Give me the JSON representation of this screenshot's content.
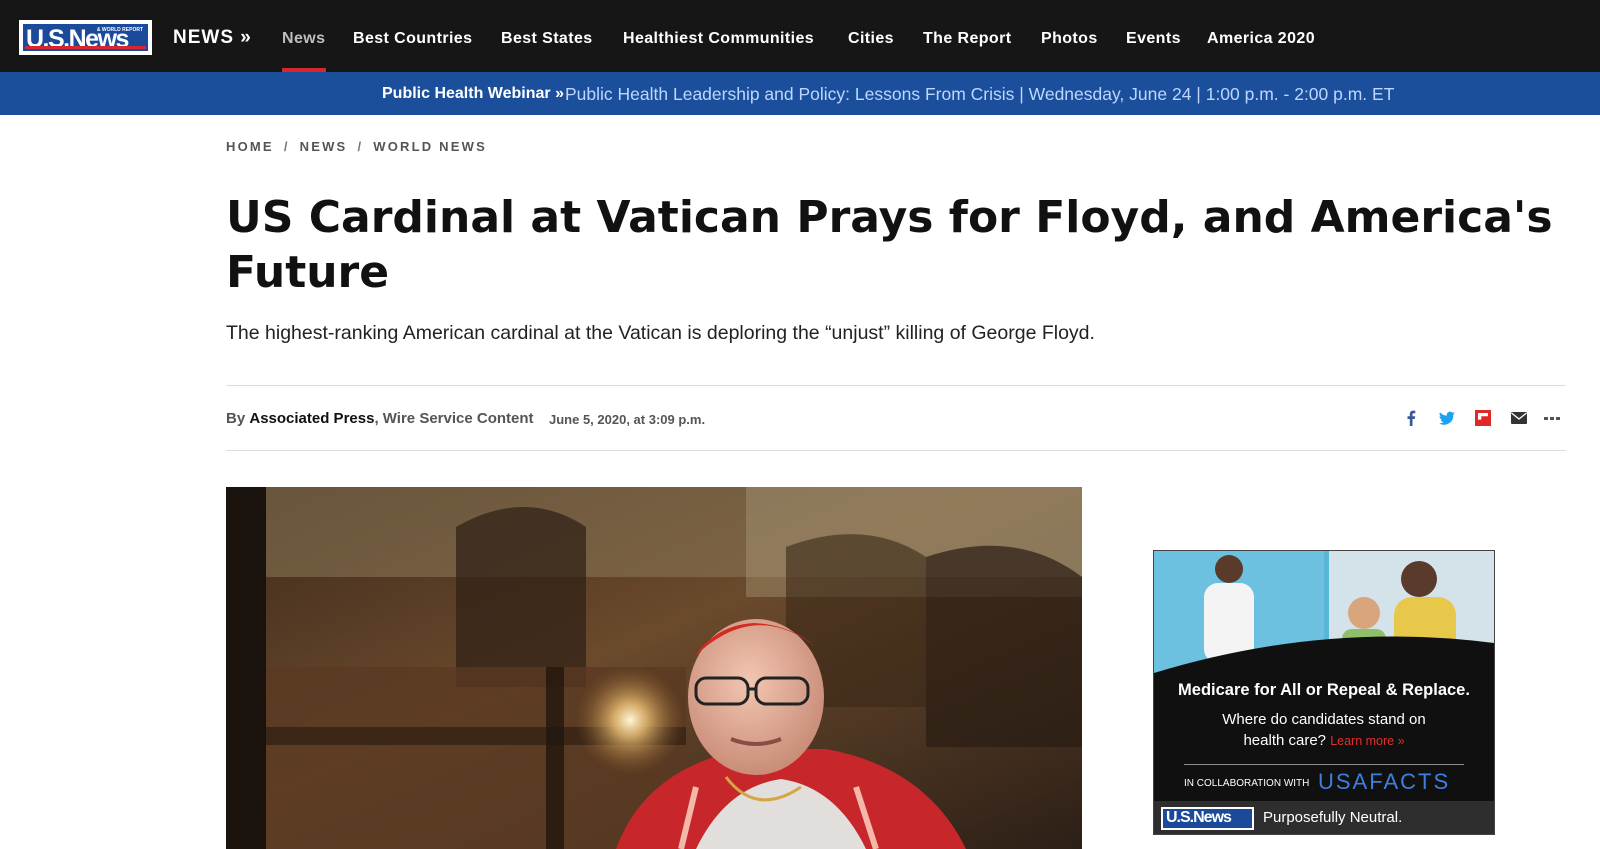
{
  "brand": {
    "logo_text": "U.S.News",
    "logo_small": "& WORLD REPORT",
    "section": "NEWS »"
  },
  "nav": {
    "items": [
      {
        "label": "News",
        "active": true
      },
      {
        "label": "Best Countries"
      },
      {
        "label": "Best States"
      },
      {
        "label": "Healthiest Communities"
      },
      {
        "label": "Cities"
      },
      {
        "label": "The Report"
      },
      {
        "label": "Photos"
      },
      {
        "label": "Events"
      },
      {
        "label": "America 2020"
      }
    ]
  },
  "webinar": {
    "label": "Public Health Webinar »",
    "link": "Public Health Leadership and Policy: Lessons From Crisis | Wednesday, June 24 | 1:00 p.m. - 2:00 p.m. ET"
  },
  "breadcrumb": [
    "HOME",
    "NEWS",
    "WORLD NEWS"
  ],
  "article": {
    "headline": "US Cardinal at Vatican Prays for Floyd, and America's Future",
    "dek": "The highest-ranking American cardinal at the Vatican is deploring the “unjust” killing of George Floyd.",
    "byline_prefix": "By",
    "author": "Associated Press",
    "service": ", Wire Service Content",
    "date": "June 5, 2020, at 3:09 p.m."
  },
  "share_icons": [
    "facebook-icon",
    "twitter-icon",
    "flipboard-icon",
    "email-icon",
    "more-icon"
  ],
  "colors": {
    "nav_bg": "#161616",
    "accent_red": "#d7262d",
    "webinar_bg": "#1b4f9c",
    "facebook": "#3b5998",
    "twitter": "#1da1f2",
    "flipboard": "#e12828"
  },
  "ad": {
    "headline": "Medicare for All or Repeal & Replace.",
    "sub_line1": "Where do candidates stand on",
    "sub_line2": "health care?",
    "learn_more": "Learn more »",
    "collab": "IN COLLABORATION WITH",
    "partner": "USAFACTS",
    "footer_logo": "U.S.News",
    "footer_text": "Purposefully Neutral."
  }
}
